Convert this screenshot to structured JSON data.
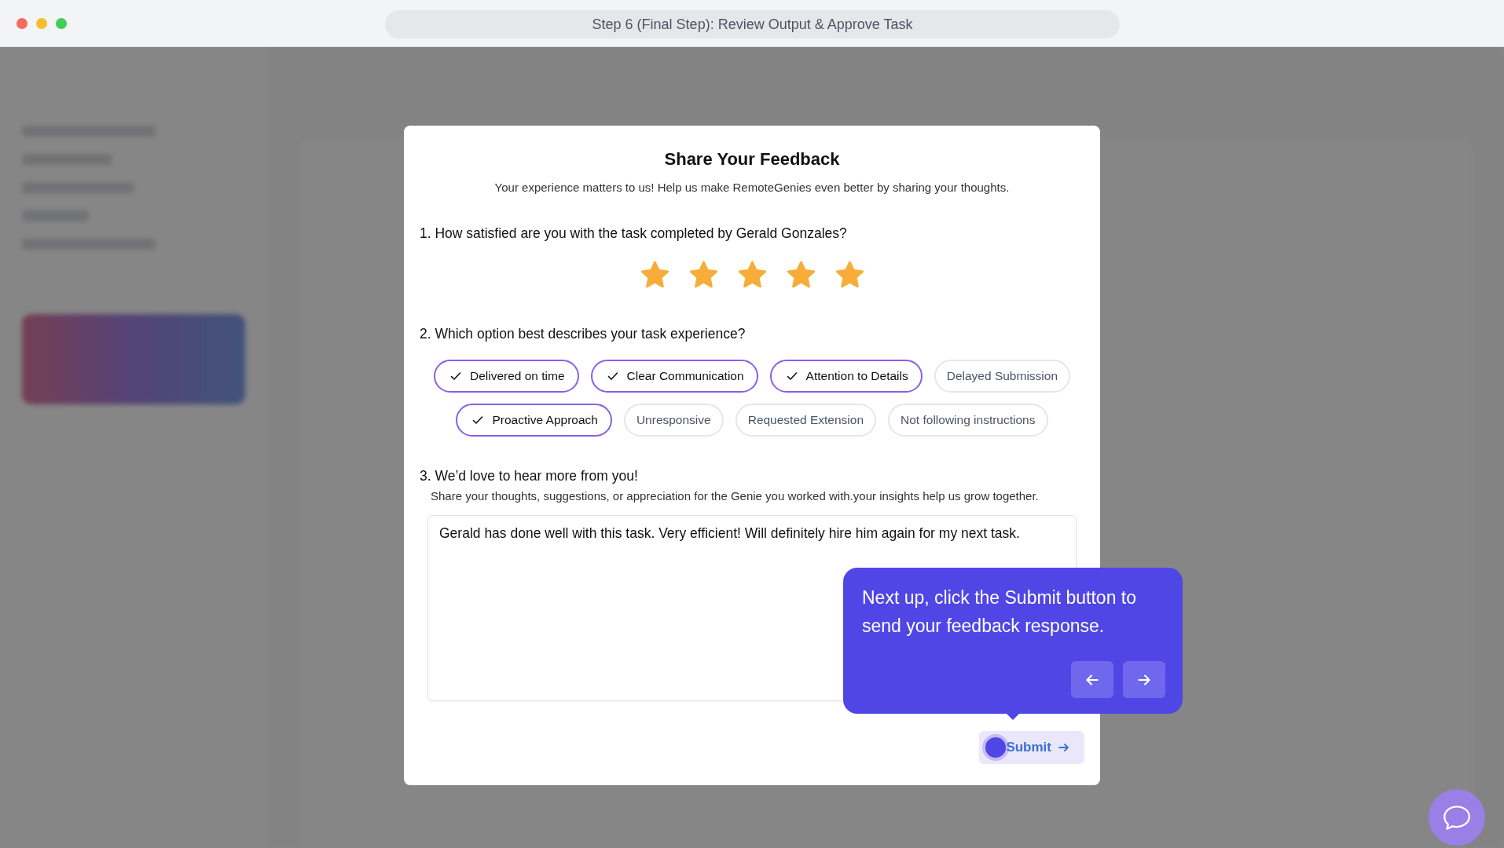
{
  "window": {
    "title": "Step 6 (Final Step): Review Output & Approve Task"
  },
  "feedback": {
    "title": "Share Your Feedback",
    "subtitle": "Your experience matters to us! Help us make RemoteGenies even better by sharing your thoughts.",
    "q1": "1. How satisfied are you with the task completed by Gerald Gonzales?",
    "stars": 5,
    "q2": "2. Which option best describes your task experience?",
    "options": [
      {
        "label": "Delivered on time",
        "selected": true
      },
      {
        "label": "Clear Communication",
        "selected": true
      },
      {
        "label": "Attention to Details",
        "selected": true
      },
      {
        "label": "Delayed Submission",
        "selected": false
      },
      {
        "label": "Proactive Approach",
        "selected": true
      },
      {
        "label": "Unresponsive",
        "selected": false
      },
      {
        "label": "Requested Extension",
        "selected": false
      },
      {
        "label": "Not following instructions",
        "selected": false
      }
    ],
    "q3": "3. We’d love to hear more from you!",
    "q3_hint": "Share your thoughts, suggestions, or appreciation for the Genie you worked with.your insights help us grow together.",
    "comment": "Gerald has done well with this task. Very efficient! Will definitely hire him again for my next task.",
    "submit": "Submit"
  },
  "tooltip": {
    "text": "Next up, click the Submit button to send your feedback response."
  }
}
